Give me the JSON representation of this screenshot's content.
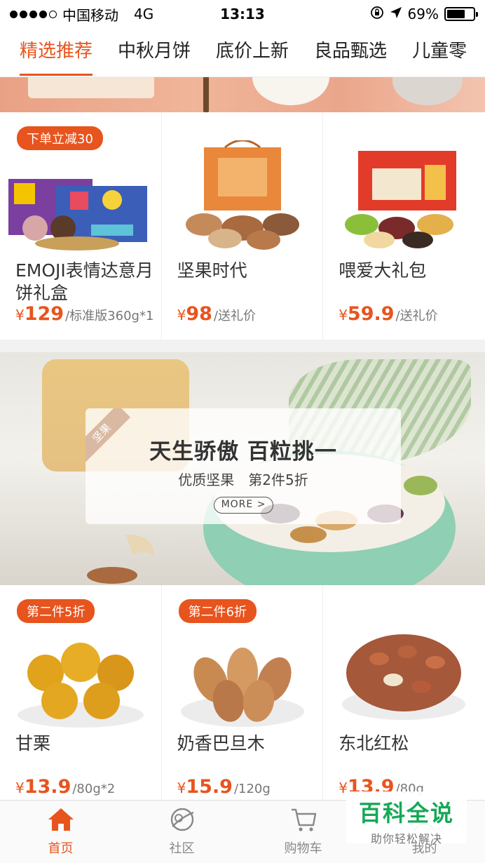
{
  "status_bar": {
    "carrier": "中国移动",
    "network": "4G",
    "time": "13:13",
    "battery": "69%",
    "battery_level": 0.69
  },
  "tabs": [
    {
      "label": "精选推荐",
      "active": true
    },
    {
      "label": "中秋月饼"
    },
    {
      "label": "底价上新"
    },
    {
      "label": "良品甄选"
    },
    {
      "label": "儿童零"
    }
  ],
  "products_row1": [
    {
      "promo": "下单立减30",
      "name": "EMOJI表情达意月饼礼盒",
      "price_symbol": "¥",
      "price": "129",
      "unit": "/标准版360g*1",
      "image": "mooncake-giftbox"
    },
    {
      "promo": "",
      "name": "坚果时代",
      "price_symbol": "¥",
      "price": "98",
      "unit": "/送礼价",
      "image": "nut-giftbag"
    },
    {
      "promo": "",
      "name": "喂爱大礼包",
      "price_symbol": "¥",
      "price": "59.9",
      "unit": "/送礼价",
      "image": "snack-giftbox"
    }
  ],
  "banner": {
    "ribbon": "坚果",
    "title": "天生骄傲 百粒挑一",
    "subtitle": "优质坚果　第2件5折",
    "more_label": "MORE"
  },
  "products_row2": [
    {
      "promo": "第二件5折",
      "name": "甘栗",
      "price_symbol": "¥",
      "price": "13.9",
      "unit": "/80g*2",
      "image": "chestnuts"
    },
    {
      "promo": "第二件6折",
      "name": "奶香巴旦木",
      "price_symbol": "¥",
      "price": "15.9",
      "unit": "/120g",
      "image": "almonds"
    },
    {
      "promo": "",
      "name": "东北红松",
      "price_symbol": "¥",
      "price": "13.9",
      "unit": "/80g",
      "image": "pine-nuts"
    }
  ],
  "bottom_nav": [
    {
      "label": "首页",
      "icon": "home-icon",
      "active": true
    },
    {
      "label": "社区",
      "icon": "community-icon"
    },
    {
      "label": "购物车",
      "icon": "cart-icon"
    },
    {
      "label": "我的",
      "icon": "profile-icon"
    }
  ],
  "watermark": {
    "title": "百科全说",
    "subtitle": "助你轻松解决"
  },
  "colors": {
    "accent": "#e8541e",
    "watermark_green": "#17a857"
  }
}
